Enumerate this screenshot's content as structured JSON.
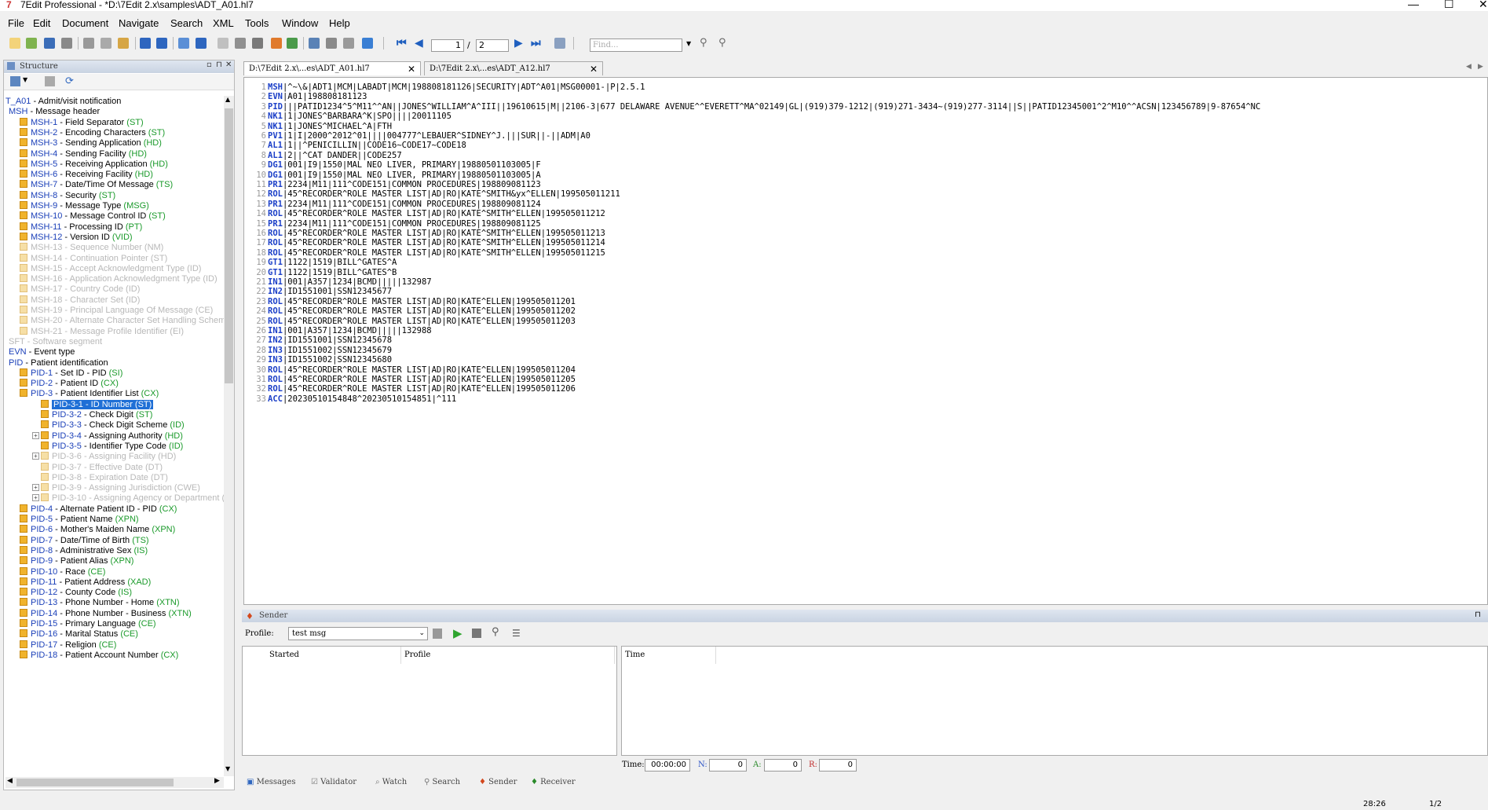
{
  "title": "7Edit Professional - *D:\\7Edit 2.x\\samples\\ADT_A01.hl7",
  "window_controls": {
    "minimize": "—",
    "maximize": "☐",
    "close": "✕"
  },
  "menu": [
    "File",
    "Edit",
    "Document",
    "Navigate",
    "Search",
    "XML",
    "Tools",
    "Window",
    "Help"
  ],
  "toolbar": {
    "page_current": "1",
    "page_sep": "/",
    "page_total": "2",
    "find_placeholder": "Find..."
  },
  "structure": {
    "title": "Structure",
    "tree": [
      {
        "code": "T_A01",
        "text": " - Admit/visit notification",
        "type": "",
        "lvl": 0,
        "state": "root"
      },
      {
        "code": "MSH",
        "text": " - Message header",
        "type": "",
        "lvl": 1,
        "state": "n"
      },
      {
        "code": "MSH-1",
        "text": " - Field Separator ",
        "type": "(ST)",
        "lvl": 2,
        "state": "n"
      },
      {
        "code": "MSH-2",
        "text": " - Encoding Characters ",
        "type": "(ST)",
        "lvl": 2,
        "state": "n"
      },
      {
        "code": "MSH-3",
        "text": " - Sending Application ",
        "type": "(HD)",
        "lvl": 2,
        "state": "n"
      },
      {
        "code": "MSH-4",
        "text": " - Sending Facility ",
        "type": "(HD)",
        "lvl": 2,
        "state": "n"
      },
      {
        "code": "MSH-5",
        "text": " - Receiving Application ",
        "type": "(HD)",
        "lvl": 2,
        "state": "n"
      },
      {
        "code": "MSH-6",
        "text": " - Receiving Facility ",
        "type": "(HD)",
        "lvl": 2,
        "state": "n"
      },
      {
        "code": "MSH-7",
        "text": " - Date/Time Of Message ",
        "type": "(TS)",
        "lvl": 2,
        "state": "n"
      },
      {
        "code": "MSH-8",
        "text": " - Security ",
        "type": "(ST)",
        "lvl": 2,
        "state": "n"
      },
      {
        "code": "MSH-9",
        "text": " - Message Type ",
        "type": "(MSG)",
        "lvl": 2,
        "state": "n"
      },
      {
        "code": "MSH-10",
        "text": " - Message Control ID ",
        "type": "(ST)",
        "lvl": 2,
        "state": "n"
      },
      {
        "code": "MSH-11",
        "text": " - Processing ID ",
        "type": "(PT)",
        "lvl": 2,
        "state": "n"
      },
      {
        "code": "MSH-12",
        "text": " - Version ID ",
        "type": "(VID)",
        "lvl": 2,
        "state": "n"
      },
      {
        "code": "MSH-13",
        "text": " - Sequence Number ",
        "type": "(NM)",
        "lvl": 2,
        "state": "d"
      },
      {
        "code": "MSH-14",
        "text": " - Continuation Pointer ",
        "type": "(ST)",
        "lvl": 2,
        "state": "d"
      },
      {
        "code": "MSH-15",
        "text": " - Accept Acknowledgment Type ",
        "type": "(ID)",
        "lvl": 2,
        "state": "d"
      },
      {
        "code": "MSH-16",
        "text": " - Application Acknowledgment Type ",
        "type": "(ID)",
        "lvl": 2,
        "state": "d"
      },
      {
        "code": "MSH-17",
        "text": " - Country Code ",
        "type": "(ID)",
        "lvl": 2,
        "state": "d"
      },
      {
        "code": "MSH-18",
        "text": " - Character Set ",
        "type": "(ID)",
        "lvl": 2,
        "state": "d"
      },
      {
        "code": "MSH-19",
        "text": " - Principal Language Of Message ",
        "type": "(CE)",
        "lvl": 2,
        "state": "d"
      },
      {
        "code": "MSH-20",
        "text": " - Alternate Character Set Handling Scheme (",
        "type": "",
        "lvl": 2,
        "state": "d"
      },
      {
        "code": "MSH-21",
        "text": " - Message Profile Identifier ",
        "type": "(EI)",
        "lvl": 2,
        "state": "d"
      },
      {
        "code": "SFT",
        "text": " - Software segment",
        "type": "",
        "lvl": 1,
        "state": "d"
      },
      {
        "code": "EVN",
        "text": " - Event type",
        "type": "",
        "lvl": 1,
        "state": "n"
      },
      {
        "code": "PID",
        "text": " - Patient identification",
        "type": "",
        "lvl": 1,
        "state": "n"
      },
      {
        "code": "PID-1",
        "text": " - Set ID - PID ",
        "type": "(SI)",
        "lvl": 2,
        "state": "n"
      },
      {
        "code": "PID-2",
        "text": " - Patient ID ",
        "type": "(CX)",
        "lvl": 2,
        "state": "n"
      },
      {
        "code": "PID-3",
        "text": " - Patient Identifier List ",
        "type": "(CX)",
        "lvl": 2,
        "state": "n"
      },
      {
        "code": "PID-3-1",
        "text": " - ID Number ",
        "type": "(ST)",
        "lvl": 3,
        "state": "sel"
      },
      {
        "code": "PID-3-2",
        "text": " - Check Digit ",
        "type": "(ST)",
        "lvl": 3,
        "state": "n"
      },
      {
        "code": "PID-3-3",
        "text": " - Check Digit Scheme ",
        "type": "(ID)",
        "lvl": 3,
        "state": "n"
      },
      {
        "code": "PID-3-4",
        "text": " - Assigning Authority ",
        "type": "(HD)",
        "lvl": 3,
        "state": "x"
      },
      {
        "code": "PID-3-5",
        "text": " - Identifier Type Code ",
        "type": "(ID)",
        "lvl": 3,
        "state": "n"
      },
      {
        "code": "PID-3-6",
        "text": " - Assigning Facility ",
        "type": "(HD)",
        "lvl": 3,
        "state": "xd"
      },
      {
        "code": "PID-3-7",
        "text": " - Effective Date ",
        "type": "(DT)",
        "lvl": 3,
        "state": "d"
      },
      {
        "code": "PID-3-8",
        "text": " - Expiration Date ",
        "type": "(DT)",
        "lvl": 3,
        "state": "d"
      },
      {
        "code": "PID-3-9",
        "text": " - Assigning Jurisdiction ",
        "type": "(CWE)",
        "lvl": 3,
        "state": "xd"
      },
      {
        "code": "PID-3-10",
        "text": " - Assigning Agency or Department (CW",
        "type": "",
        "lvl": 3,
        "state": "xd"
      },
      {
        "code": "PID-4",
        "text": " - Alternate Patient ID - PID ",
        "type": "(CX)",
        "lvl": 2,
        "state": "n"
      },
      {
        "code": "PID-5",
        "text": " - Patient Name ",
        "type": "(XPN)",
        "lvl": 2,
        "state": "n"
      },
      {
        "code": "PID-6",
        "text": " - Mother's Maiden Name ",
        "type": "(XPN)",
        "lvl": 2,
        "state": "n"
      },
      {
        "code": "PID-7",
        "text": " - Date/Time of Birth ",
        "type": "(TS)",
        "lvl": 2,
        "state": "n"
      },
      {
        "code": "PID-8",
        "text": " - Administrative Sex ",
        "type": "(IS)",
        "lvl": 2,
        "state": "n"
      },
      {
        "code": "PID-9",
        "text": " - Patient Alias ",
        "type": "(XPN)",
        "lvl": 2,
        "state": "n"
      },
      {
        "code": "PID-10",
        "text": " - Race ",
        "type": "(CE)",
        "lvl": 2,
        "state": "n"
      },
      {
        "code": "PID-11",
        "text": " - Patient Address ",
        "type": "(XAD)",
        "lvl": 2,
        "state": "n"
      },
      {
        "code": "PID-12",
        "text": " - County Code ",
        "type": "(IS)",
        "lvl": 2,
        "state": "n"
      },
      {
        "code": "PID-13",
        "text": " - Phone Number - Home ",
        "type": "(XTN)",
        "lvl": 2,
        "state": "n"
      },
      {
        "code": "PID-14",
        "text": " - Phone Number - Business ",
        "type": "(XTN)",
        "lvl": 2,
        "state": "n"
      },
      {
        "code": "PID-15",
        "text": " - Primary Language ",
        "type": "(CE)",
        "lvl": 2,
        "state": "n"
      },
      {
        "code": "PID-16",
        "text": " - Marital Status ",
        "type": "(CE)",
        "lvl": 2,
        "state": "n"
      },
      {
        "code": "PID-17",
        "text": " - Religion ",
        "type": "(CE)",
        "lvl": 2,
        "state": "n"
      },
      {
        "code": "PID-18",
        "text": " - Patient Account Number ",
        "type": "(CX)",
        "lvl": 2,
        "state": "n"
      }
    ]
  },
  "editor": {
    "tabs": [
      {
        "label": "D:\\7Edit 2.x\\...es\\ADT_A01.hl7",
        "close": "✕"
      },
      {
        "label": "D:\\7Edit 2.x\\...es\\ADT_A12.hl7",
        "close": "✕"
      }
    ],
    "lines": [
      {
        "seg": "MSH",
        "rest": "|^~\\&|ADT1|MCM|LABADT|MCM|198808181126|SECURITY|ADT^A01|MSG00001-|P|2.5.1"
      },
      {
        "seg": "EVN",
        "rest": "|A01|198808181123"
      },
      {
        "seg": "PID",
        "rest": "|||PATID1234^5^M11^^AN||JONES^WILLIAM^A^III||19610615|M||2106-3|677 DELAWARE AVENUE^^EVERETT^MA^02149|GL|(919)379-1212|(919)271-3434~(919)277-3114||S||PATID12345001^2^M10^^ACSN|123456789|9-87654^NC"
      },
      {
        "seg": "NK1",
        "rest": "|1|JONES^BARBARA^K|SPO||||20011105"
      },
      {
        "seg": "NK1",
        "rest": "|1|JONES^MICHAEL^A|FTH"
      },
      {
        "seg": "PV1",
        "rest": "|1|I|2000^2012^01||||004777^LEBAUER^SIDNEY^J.|||SUR||-||ADM|A0"
      },
      {
        "seg": "AL1",
        "rest": "|1||^PENICILLIN||CODE16~CODE17~CODE18"
      },
      {
        "seg": "AL1",
        "rest": "|2||^CAT DANDER||CODE257"
      },
      {
        "seg": "DG1",
        "rest": "|001|I9|1550|MAL NEO LIVER, PRIMARY|19880501103005|F"
      },
      {
        "seg": "DG1",
        "rest": "|001|I9|1550|MAL NEO LIVER, PRIMARY|19880501103005|A"
      },
      {
        "seg": "PR1",
        "rest": "|2234|M11|111^CODE151|COMMON PROCEDURES|198809081123"
      },
      {
        "seg": "ROL",
        "rest": "|45^RECORDER^ROLE MASTER LIST|AD|RO|KATE^SMITH&yx^ELLEN|199505011211"
      },
      {
        "seg": "PR1",
        "rest": "|2234|M11|111^CODE151|COMMON PROCEDURES|198809081124"
      },
      {
        "seg": "ROL",
        "rest": "|45^RECORDER^ROLE MASTER LIST|AD|RO|KATE^SMITH^ELLEN|199505011212"
      },
      {
        "seg": "PR1",
        "rest": "|2234|M11|111^CODE151|COMMON PROCEDURES|198809081125"
      },
      {
        "seg": "ROL",
        "rest": "|45^RECORDER^ROLE MASTER LIST|AD|RO|KATE^SMITH^ELLEN|199505011213"
      },
      {
        "seg": "ROL",
        "rest": "|45^RECORDER^ROLE MASTER LIST|AD|RO|KATE^SMITH^ELLEN|199505011214"
      },
      {
        "seg": "ROL",
        "rest": "|45^RECORDER^ROLE MASTER LIST|AD|RO|KATE^SMITH^ELLEN|199505011215"
      },
      {
        "seg": "GT1",
        "rest": "|1122|1519|BILL^GATES^A"
      },
      {
        "seg": "GT1",
        "rest": "|1122|1519|BILL^GATES^B"
      },
      {
        "seg": "IN1",
        "rest": "|001|A357|1234|BCMD|||||132987"
      },
      {
        "seg": "IN2",
        "rest": "|ID1551001|SSN12345677"
      },
      {
        "seg": "ROL",
        "rest": "|45^RECORDER^ROLE MASTER LIST|AD|RO|KATE^ELLEN|199505011201"
      },
      {
        "seg": "ROL",
        "rest": "|45^RECORDER^ROLE MASTER LIST|AD|RO|KATE^ELLEN|199505011202"
      },
      {
        "seg": "ROL",
        "rest": "|45^RECORDER^ROLE MASTER LIST|AD|RO|KATE^ELLEN|199505011203"
      },
      {
        "seg": "IN1",
        "rest": "|001|A357|1234|BCMD|||||132988"
      },
      {
        "seg": "IN2",
        "rest": "|ID1551001|SSN12345678"
      },
      {
        "seg": "IN3",
        "rest": "|ID1551002|SSN12345679"
      },
      {
        "seg": "IN3",
        "rest": "|ID1551002|SSN12345680"
      },
      {
        "seg": "ROL",
        "rest": "|45^RECORDER^ROLE MASTER LIST|AD|RO|KATE^ELLEN|199505011204"
      },
      {
        "seg": "ROL",
        "rest": "|45^RECORDER^ROLE MASTER LIST|AD|RO|KATE^ELLEN|199505011205"
      },
      {
        "seg": "ROL",
        "rest": "|45^RECORDER^ROLE MASTER LIST|AD|RO|KATE^ELLEN|199505011206"
      },
      {
        "seg": "ACC",
        "rest": "|20230510154848^20230510154851|^111"
      }
    ]
  },
  "sender": {
    "title": "Sender",
    "profile_label": "Profile:",
    "profile_value": "test msg",
    "col_started": "Started",
    "col_profile": "Profile",
    "col_time": "Time",
    "time_label": "Time:",
    "time_value": "00:00:00",
    "n_label": "N:",
    "n_value": "0",
    "a_label": "A:",
    "a_value": "0",
    "r_label": "R:",
    "r_value": "0"
  },
  "bottom_tabs": [
    "Messages",
    "Validator",
    "Watch",
    "Search",
    "Sender",
    "Receiver"
  ],
  "status": {
    "position": "28:26",
    "page": "1/2"
  },
  "colors": {
    "accent": "#1f6fd6",
    "segment": "#1b3fc8",
    "type": "#1a9a2a"
  }
}
